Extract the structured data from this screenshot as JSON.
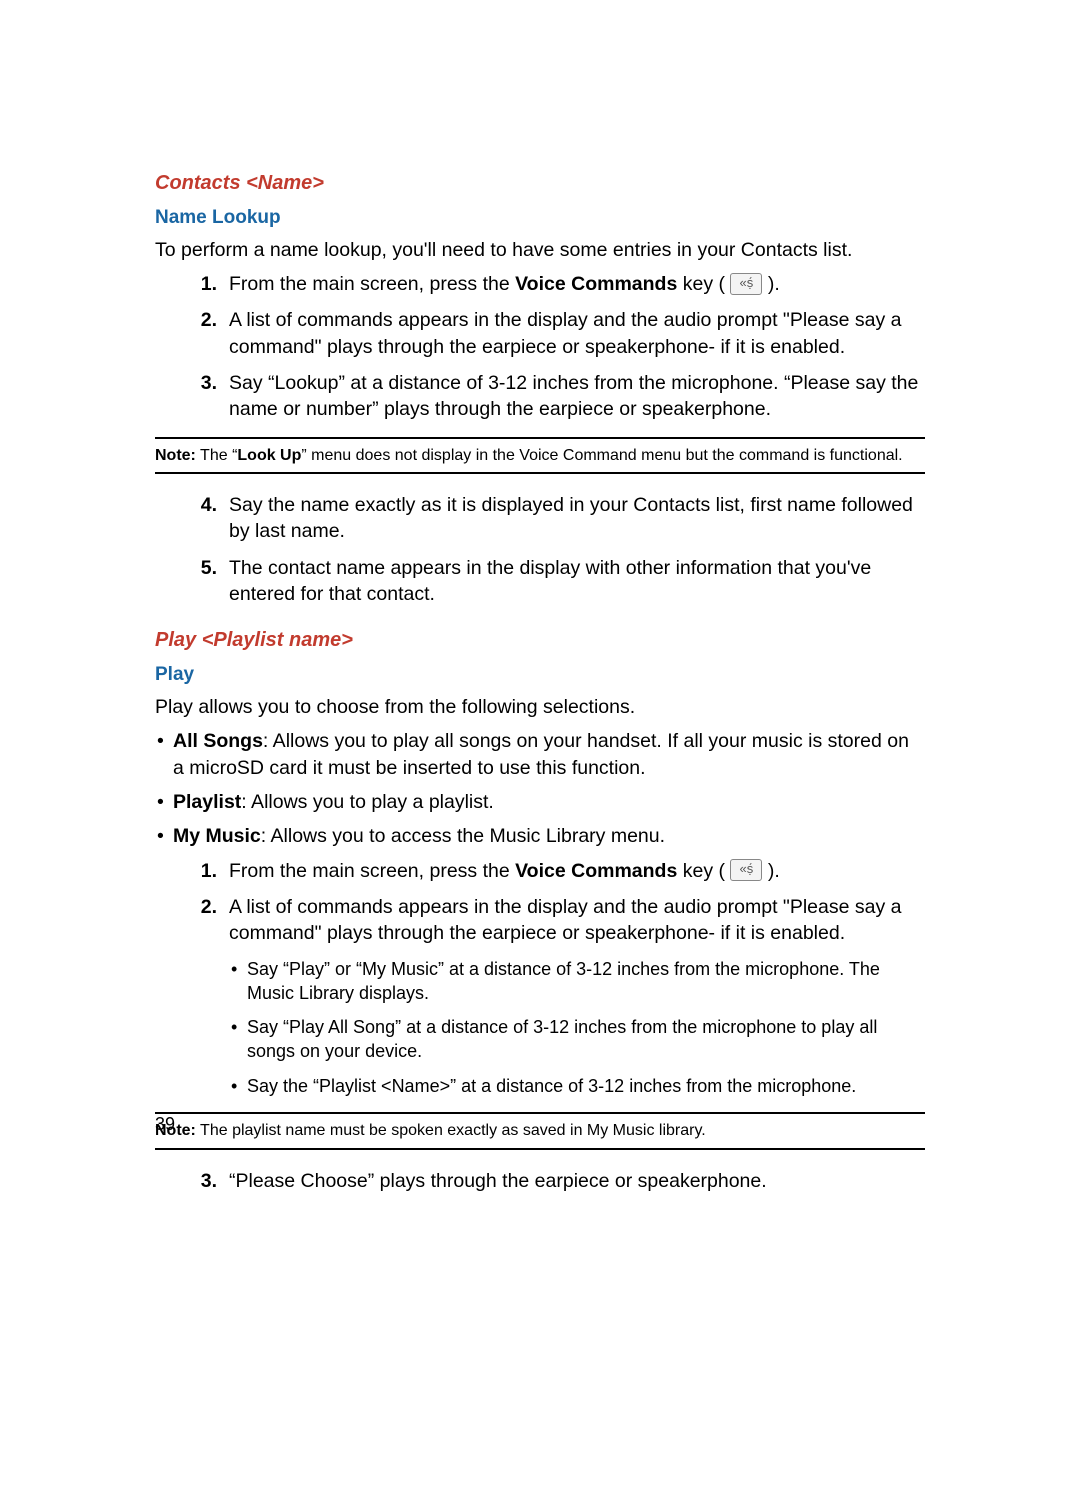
{
  "section1": {
    "heading": "Contacts <Name>",
    "subheading": "Name Lookup",
    "intro": "To perform a name lookup, you'll need to have some entries in your Contacts list.",
    "steps_a": [
      {
        "n": "1.",
        "pre": "From the main screen, press the ",
        "bold": "Voice Commands",
        "post1": " key (",
        "post2": ")."
      },
      {
        "n": "2.",
        "text": "A list of commands appears in the display and the audio prompt \"Please say a command\" plays through the earpiece or speakerphone- if it is enabled."
      },
      {
        "n": "3.",
        "text": "Say “Lookup” at a distance of 3-12 inches from the microphone. “Please say the name or number” plays through the earpiece or speakerphone."
      }
    ],
    "note": {
      "label": "Note:",
      "pre": " The “",
      "bold": "Look Up",
      "post": "” menu does not display in the Voice Command menu but the command is functional."
    },
    "steps_b": [
      {
        "n": "4.",
        "text": "Say the name exactly as it is displayed in your Contacts list, first name followed by last name."
      },
      {
        "n": "5.",
        "text": "The contact name appears in the display with other information that you've entered for that contact."
      }
    ]
  },
  "section2": {
    "heading": "Play <Playlist name>",
    "subheading": "Play",
    "intro": "Play allows you to choose from the following selections.",
    "bullets": [
      {
        "bold": "All Songs",
        "text": ": Allows you to play all songs on your handset. If all your music is stored on a microSD card it must be inserted to use this function."
      },
      {
        "bold": "Playlist",
        "text": ": Allows you to play a playlist."
      },
      {
        "bold": "My Music",
        "text": ": Allows you to access the Music Library menu."
      }
    ],
    "steps": [
      {
        "n": "1.",
        "pre": "From the main screen, press the ",
        "bold": "Voice Commands",
        "post1": " key (",
        "post2": ")."
      },
      {
        "n": "2.",
        "text": "A list of commands appears in the display and the audio prompt \"Please say a command\" plays through the earpiece or speakerphone- if it is enabled."
      }
    ],
    "sub_bullets": [
      "Say “Play” or “My Music” at a distance of 3-12 inches from the microphone. The Music Library displays.",
      "Say “Play All Song” at a distance of 3-12 inches from the microphone to play all songs on your device.",
      "Say the “Playlist <Name>” at a distance of 3-12 inches from the microphone."
    ],
    "note": {
      "label": "Note:",
      "text": " The playlist name must be spoken exactly as saved in My Music library."
    },
    "step3": {
      "n": "3.",
      "text": "“Please Choose” plays through the earpiece or speakerphone."
    }
  },
  "page_number": "39",
  "icon_glyph": "«ṣ́"
}
